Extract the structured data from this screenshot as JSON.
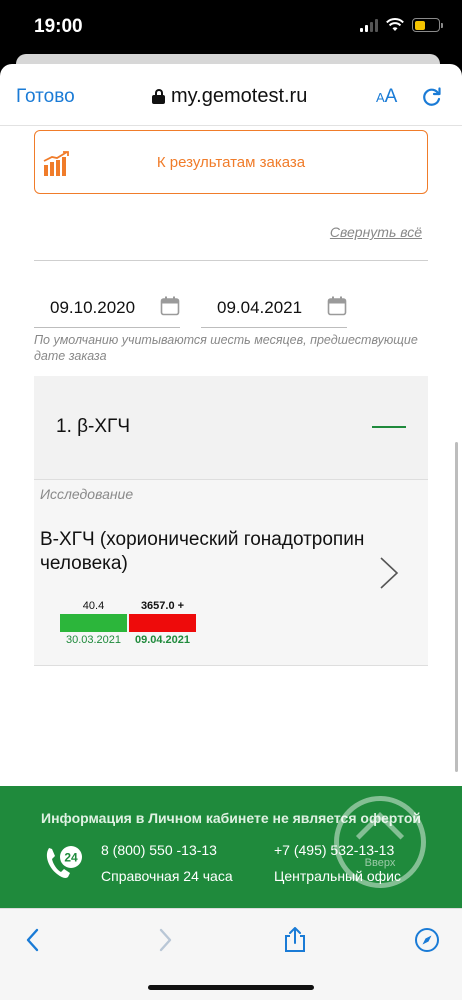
{
  "status_bar": {
    "time": "19:00"
  },
  "browser": {
    "done_label": "Готово",
    "url": "my.gemotest.ru",
    "text_size_small": "A",
    "text_size_large": "A"
  },
  "page": {
    "results_button_label": "К результатам заказа",
    "collapse_all_label": "Свернуть всё",
    "date_from": "09.10.2020",
    "date_to": "09.04.2021",
    "date_hint": "По умолчанию учитываются шесть месяцев, предшествующие дате заказа",
    "section_title": "1. β-ХГЧ",
    "study_label": "Исследование",
    "study_name": "B-ХГЧ (хорионический гонадотропин человека)",
    "results": [
      {
        "value": "40.4",
        "date": "30.03.2021",
        "status_color": "#2cb63b"
      },
      {
        "value": "3657.0 +",
        "date": "09.04.2021",
        "status_color": "#ee0b0b"
      }
    ]
  },
  "footer": {
    "notice": "Информация в Личном кабинете не является офертой",
    "phone_1": "8 (800) 550 -13-13",
    "phone_1_label": "Справочная 24 часа",
    "phone_2": "+7 (495) 532-13-13",
    "phone_2_label": "Центральный офис",
    "phone_badge": "24",
    "up_label": "Вверх"
  },
  "colors": {
    "accent_orange": "#f07c2a",
    "brand_green": "#1f8a3c",
    "link_blue": "#1a7bd6"
  }
}
